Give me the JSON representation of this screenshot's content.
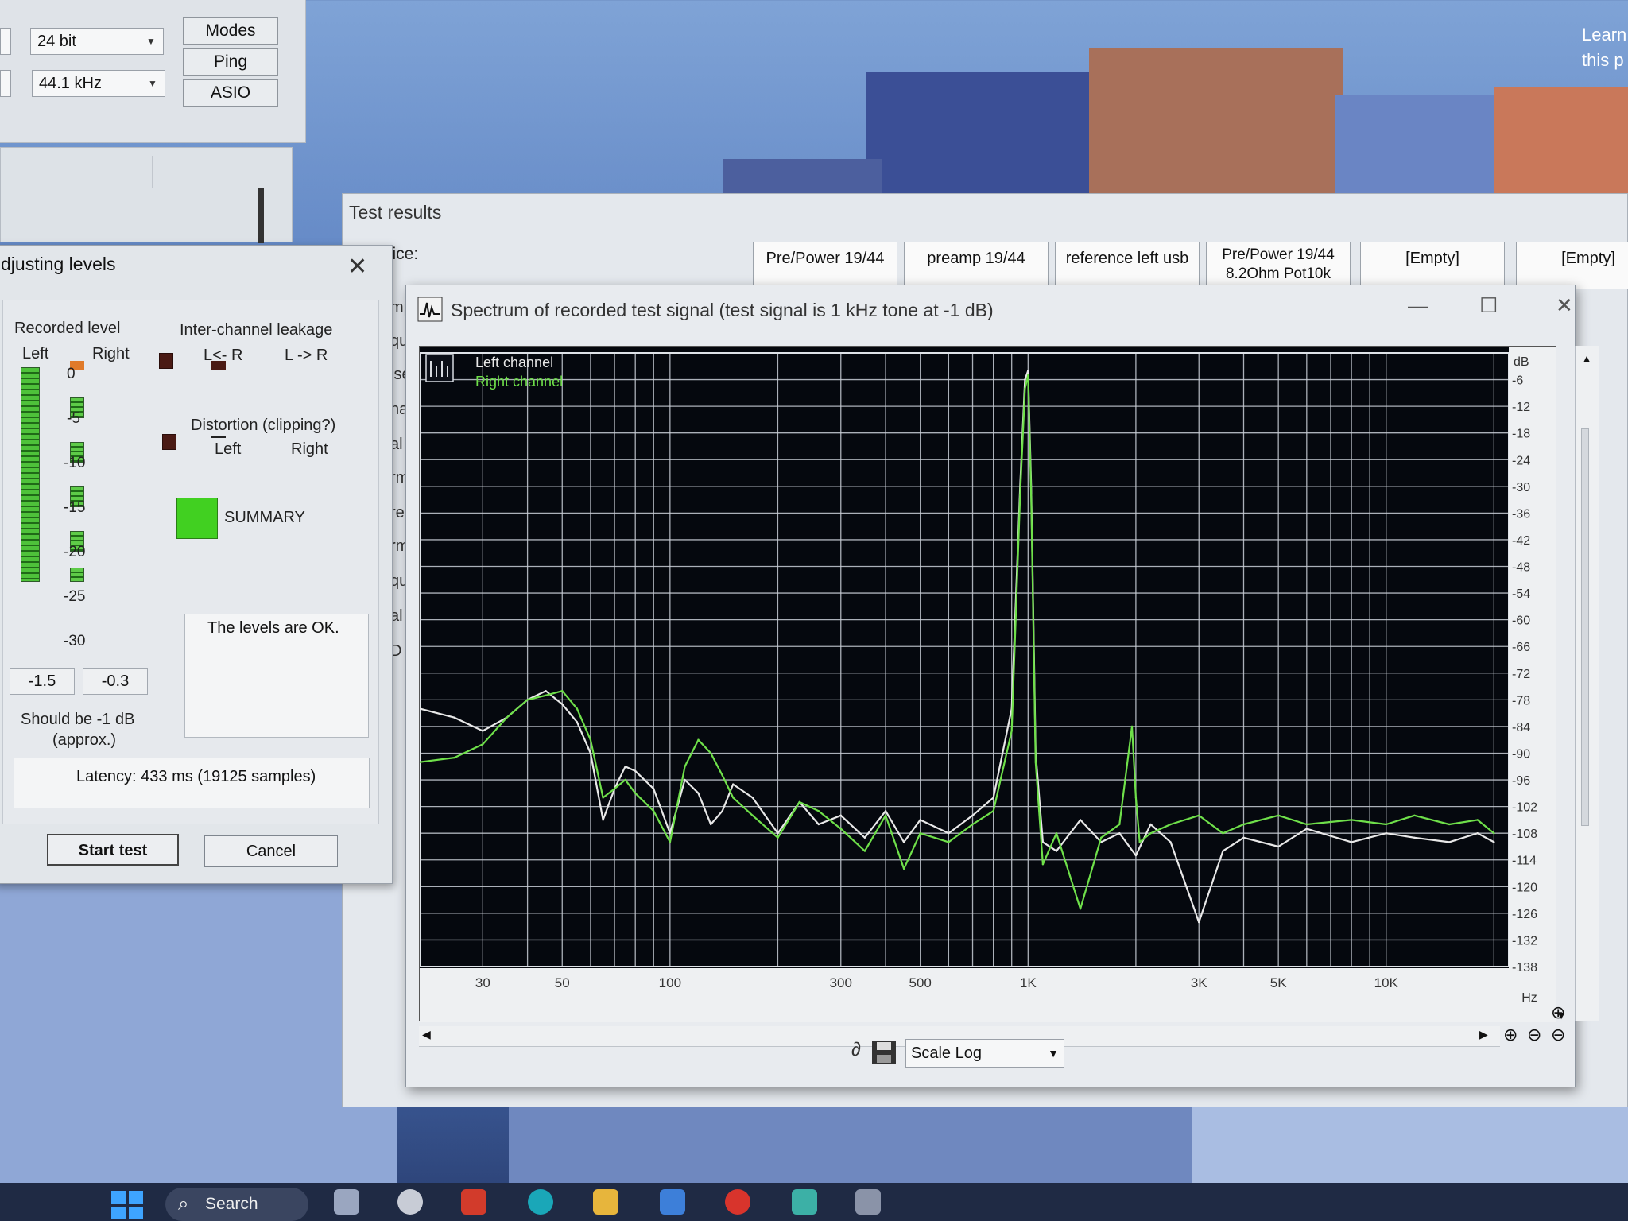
{
  "top_window": {
    "bit_depth": "24 bit",
    "sample_rate": "44.1 kHz",
    "modes_button": "Modes",
    "ping_button": "Ping",
    "asio_button": "ASIO"
  },
  "test_results": {
    "title": "Test results",
    "device_label": "vice:",
    "tabs": [
      {
        "label": "Pre/Power 19/44"
      },
      {
        "label": "preamp 19/44"
      },
      {
        "label": "reference left usb"
      },
      {
        "label": "Pre/Power 19/44 8.2Ohm Pot10k"
      },
      {
        "label": "[Empty]"
      },
      {
        "label": "[Empty]"
      }
    ],
    "side_labels": [
      "mp",
      "qu",
      "ise",
      "na",
      "al",
      "rm",
      "re",
      "rm",
      "qu",
      "al",
      "D"
    ]
  },
  "adjust_dialog": {
    "title": "djusting levels",
    "recorded_level": "Recorded level",
    "left": "Left",
    "right": "Right",
    "scale": [
      "0",
      "-5",
      "-10",
      "-15",
      "-20",
      "-25",
      "-30"
    ],
    "left_value": "-1.5",
    "right_value": "-0.3",
    "should_be": "Should be  -1 dB",
    "approx": "(approx.)",
    "inter_channel": "Inter-channel leakage",
    "l_from_r": "L<- R",
    "l_to_r": "L -> R",
    "distortion": "Distortion (clipping?)",
    "dist_left": "Left",
    "dist_right": "Right",
    "summary": "SUMMARY",
    "levels_ok": "The levels are OK.",
    "latency": "Latency: 433 ms (19125 samples)",
    "start_test": "Start test",
    "cancel": "Cancel"
  },
  "spectrum": {
    "title": "Spectrum of recorded test signal (test signal is 1 kHz tone at -1 dB)",
    "scale_label": "Scale",
    "scale_value": "Log"
  },
  "taskbar": {
    "search": "Search"
  },
  "wallpaper_text": [
    "Learn",
    "this p"
  ],
  "chart_data": {
    "type": "line",
    "title": "",
    "xlabel": "Hz",
    "ylabel": "dB",
    "xscale": "log",
    "xlim": [
      20,
      22000
    ],
    "ylim": [
      -138,
      0
    ],
    "x_ticks": [
      {
        "value": 30,
        "label": "30"
      },
      {
        "value": 50,
        "label": "50"
      },
      {
        "value": 100,
        "label": "100"
      },
      {
        "value": 300,
        "label": "300"
      },
      {
        "value": 500,
        "label": "500"
      },
      {
        "value": 1000,
        "label": "1K"
      },
      {
        "value": 3000,
        "label": "3K"
      },
      {
        "value": 5000,
        "label": "5K"
      },
      {
        "value": 10000,
        "label": "10K"
      }
    ],
    "y_ticks": [
      {
        "value": -6,
        "label": "-6"
      },
      {
        "value": -12,
        "label": "-12"
      },
      {
        "value": -18,
        "label": "-18"
      },
      {
        "value": -24,
        "label": "-24"
      },
      {
        "value": -30,
        "label": "-30"
      },
      {
        "value": -36,
        "label": "-36"
      },
      {
        "value": -42,
        "label": "-42"
      },
      {
        "value": -48,
        "label": "-48"
      },
      {
        "value": -54,
        "label": "-54"
      },
      {
        "value": -60,
        "label": "-60"
      },
      {
        "value": -66,
        "label": "-66"
      },
      {
        "value": -72,
        "label": "-72"
      },
      {
        "value": -78,
        "label": "-78"
      },
      {
        "value": -84,
        "label": "-84"
      },
      {
        "value": -90,
        "label": "-90"
      },
      {
        "value": -96,
        "label": "-96"
      },
      {
        "value": -102,
        "label": "-102"
      },
      {
        "value": -108,
        "label": "-108"
      },
      {
        "value": -114,
        "label": "-114"
      },
      {
        "value": -120,
        "label": "-120"
      },
      {
        "value": -126,
        "label": "-126"
      },
      {
        "value": -132,
        "label": "-132"
      },
      {
        "value": -138,
        "label": "-138"
      }
    ],
    "grid": true,
    "legend_position": "top-left",
    "series": [
      {
        "name": "Left channel",
        "color": "#e8e8e8",
        "x": [
          20,
          25,
          30,
          35,
          40,
          45,
          50,
          55,
          60,
          65,
          70,
          75,
          80,
          90,
          100,
          110,
          120,
          130,
          140,
          150,
          170,
          200,
          230,
          260,
          300,
          350,
          400,
          450,
          500,
          600,
          700,
          800,
          900,
          950,
          980,
          1000,
          1020,
          1050,
          1100,
          1200,
          1400,
          1600,
          1800,
          2000,
          2200,
          2500,
          3000,
          3500,
          4000,
          5000,
          6000,
          8000,
          10000,
          12000,
          15000,
          18000,
          20000
        ],
        "y": [
          -80,
          -82,
          -85,
          -82,
          -78,
          -76,
          -79,
          -83,
          -90,
          -105,
          -98,
          -93,
          -94,
          -98,
          -108,
          -96,
          -99,
          -106,
          -103,
          -97,
          -100,
          -108,
          -101,
          -106,
          -104,
          -109,
          -103,
          -110,
          -105,
          -108,
          -104,
          -100,
          -80,
          -30,
          -6,
          -4,
          -30,
          -90,
          -110,
          -112,
          -105,
          -110,
          -108,
          -113,
          -106,
          -110,
          -128,
          -112,
          -109,
          -111,
          -107,
          -110,
          -108,
          -109,
          -110,
          -108,
          -110
        ]
      },
      {
        "name": "Right channel",
        "color": "#6fe04a",
        "x": [
          20,
          25,
          30,
          35,
          40,
          45,
          50,
          55,
          60,
          65,
          70,
          75,
          80,
          90,
          100,
          110,
          120,
          130,
          140,
          150,
          170,
          200,
          230,
          260,
          300,
          350,
          400,
          450,
          500,
          600,
          700,
          800,
          900,
          950,
          980,
          1000,
          1020,
          1050,
          1100,
          1200,
          1400,
          1600,
          1800,
          1950,
          2000,
          2050,
          2200,
          2500,
          3000,
          3500,
          4000,
          5000,
          6000,
          8000,
          10000,
          12000,
          15000,
          18000,
          20000
        ],
        "y": [
          -92,
          -91,
          -88,
          -82,
          -78,
          -77,
          -76,
          -80,
          -87,
          -100,
          -98,
          -96,
          -99,
          -103,
          -110,
          -93,
          -87,
          -90,
          -95,
          -100,
          -104,
          -109,
          -101,
          -103,
          -107,
          -112,
          -104,
          -116,
          -108,
          -110,
          -106,
          -103,
          -85,
          -32,
          -8,
          -5,
          -32,
          -92,
          -115,
          -108,
          -125,
          -109,
          -106,
          -84,
          -100,
          -110,
          -108,
          -106,
          -104,
          -108,
          -106,
          -104,
          -106,
          -105,
          -106,
          -104,
          -106,
          -105,
          -108
        ]
      }
    ]
  }
}
